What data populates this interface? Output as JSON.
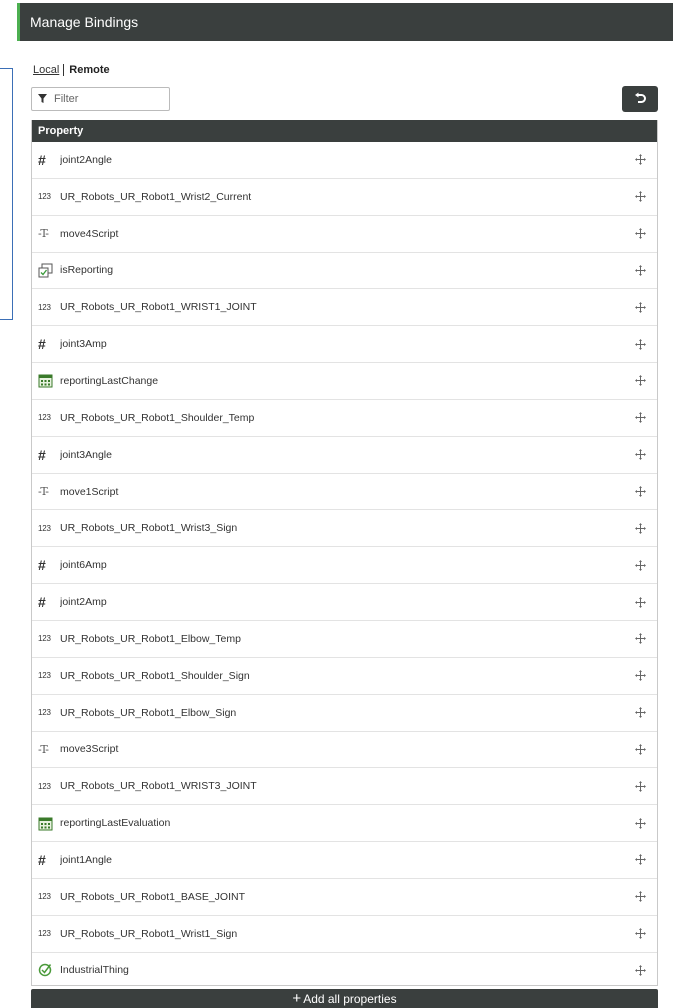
{
  "title": "Manage Bindings",
  "tabs": {
    "local": "Local",
    "remote": "Remote"
  },
  "filter": {
    "placeholder": "Filter"
  },
  "table": {
    "header": "Property",
    "rows": [
      {
        "type": "number",
        "name": "joint2Angle"
      },
      {
        "type": "integer",
        "name": "UR_Robots_UR_Robot1_Wrist2_Current"
      },
      {
        "type": "string",
        "name": "move4Script"
      },
      {
        "type": "boolean",
        "name": "isReporting"
      },
      {
        "type": "integer",
        "name": "UR_Robots_UR_Robot1_WRIST1_JOINT"
      },
      {
        "type": "number",
        "name": "joint3Amp"
      },
      {
        "type": "datetime",
        "name": "reportingLastChange"
      },
      {
        "type": "integer",
        "name": "UR_Robots_UR_Robot1_Shoulder_Temp"
      },
      {
        "type": "number",
        "name": "joint3Angle"
      },
      {
        "type": "string",
        "name": "move1Script"
      },
      {
        "type": "integer",
        "name": "UR_Robots_UR_Robot1_Wrist3_Sign"
      },
      {
        "type": "number",
        "name": "joint6Amp"
      },
      {
        "type": "number",
        "name": "joint2Amp"
      },
      {
        "type": "integer",
        "name": "UR_Robots_UR_Robot1_Elbow_Temp"
      },
      {
        "type": "integer",
        "name": "UR_Robots_UR_Robot1_Shoulder_Sign"
      },
      {
        "type": "integer",
        "name": "UR_Robots_UR_Robot1_Elbow_Sign"
      },
      {
        "type": "string",
        "name": "move3Script"
      },
      {
        "type": "integer",
        "name": "UR_Robots_UR_Robot1_WRIST3_JOINT"
      },
      {
        "type": "datetime",
        "name": "reportingLastEvaluation"
      },
      {
        "type": "number",
        "name": "joint1Angle"
      },
      {
        "type": "integer",
        "name": "UR_Robots_UR_Robot1_BASE_JOINT"
      },
      {
        "type": "integer",
        "name": "UR_Robots_UR_Robot1_Wrist1_Sign"
      },
      {
        "type": "thingname",
        "name": "IndustrialThing"
      }
    ]
  },
  "type_glyphs": {
    "number": "#",
    "integer": "123",
    "string": "-T-"
  },
  "add_all_label": "Add all properties",
  "colors": {
    "header_bg": "#3a3f3e",
    "accent": "#4caf50",
    "frame_blue": "#3b6fb6"
  }
}
